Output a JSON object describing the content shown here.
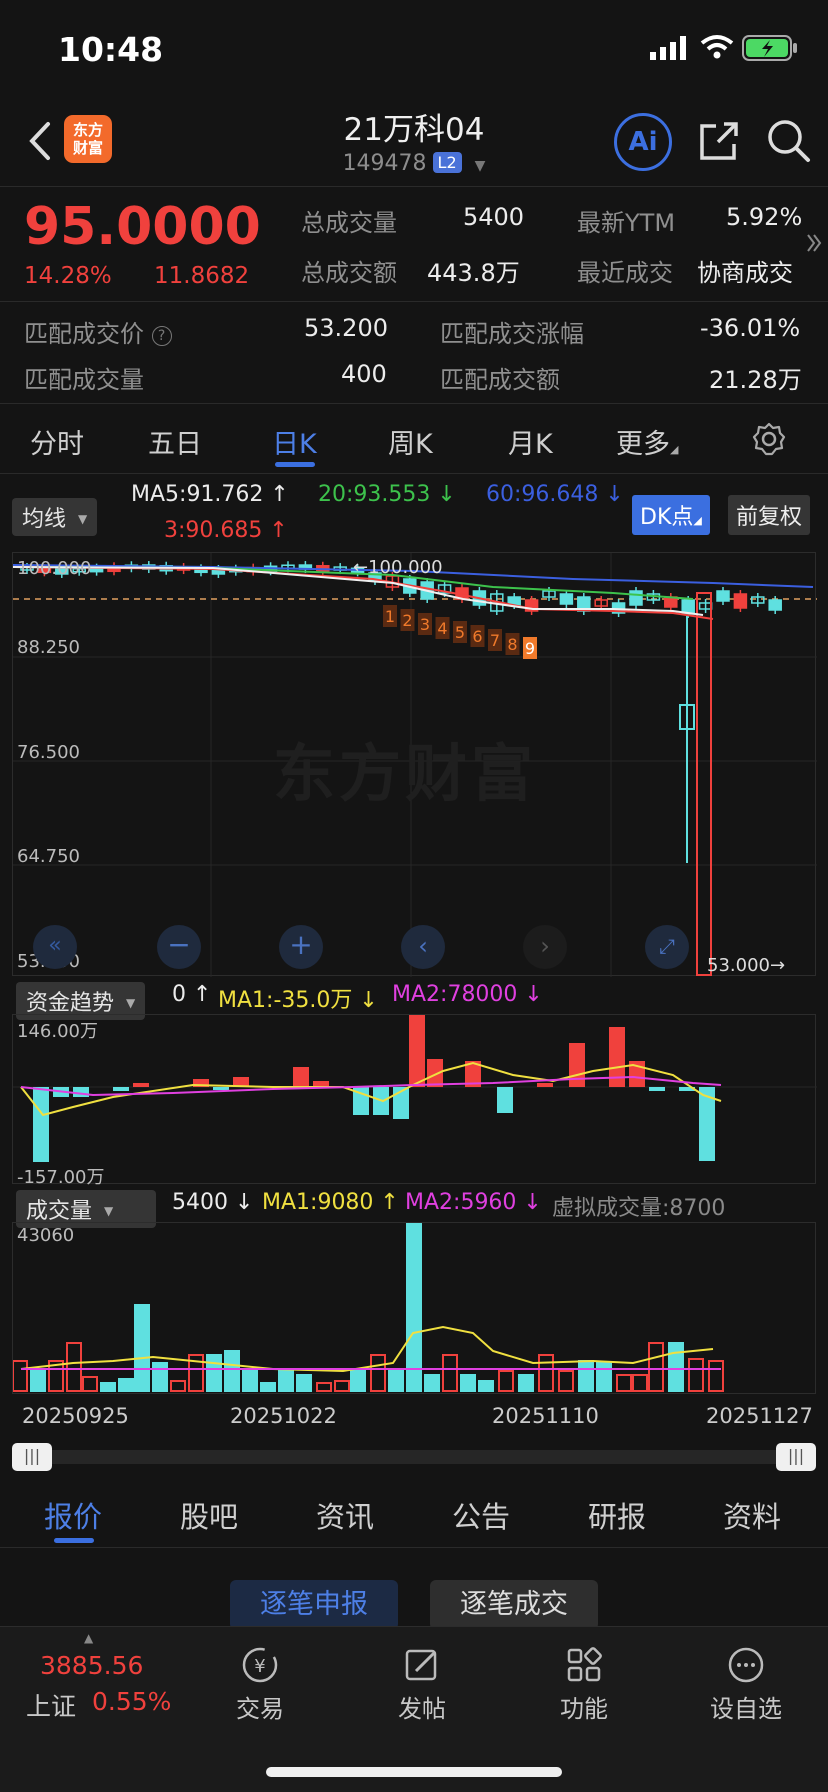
{
  "status_bar": {
    "time": "10:48"
  },
  "header": {
    "logo_text": "东方财富",
    "title": "21万科04",
    "code": "149478",
    "level_badge": "L2",
    "ai_label": "Ai"
  },
  "quote": {
    "price": "95.0000",
    "change_pct": "14.28%",
    "change_amt": "11.8682",
    "rows": [
      {
        "label": "总成交量",
        "value": "5400",
        "label2": "最新YTM",
        "value2": "5.92%"
      },
      {
        "label": "总成交额",
        "value": "443.8万",
        "label2": "最近成交",
        "value2": "协商成交"
      }
    ]
  },
  "match": {
    "price_label": "匹配成交价",
    "price_value": "53.200",
    "change_label": "匹配成交涨幅",
    "change_value": "-36.01%",
    "volume_label": "匹配成交量",
    "volume_value": "400",
    "amount_label": "匹配成交额",
    "amount_value": "21.28万"
  },
  "k_tabs": [
    "分时",
    "五日",
    "日K",
    "周K",
    "月K",
    "更多"
  ],
  "ma_bar": {
    "selector": "均线",
    "ma5": "MA5:91.762",
    "ma20": "20:93.553",
    "ma60": "60:96.648",
    "ma3": "3:90.685",
    "dk_button": "DK点",
    "restore_button": "前复权"
  },
  "main_chart": {
    "y_labels": [
      "100.000",
      "88.250",
      "76.500",
      "64.750",
      "53.000"
    ],
    "max_label": "←100.000",
    "min_label": "53.000→",
    "watermark": "东方财富",
    "markers": [
      "1",
      "2",
      "3",
      "4",
      "5",
      "6",
      "7",
      "8",
      "9"
    ]
  },
  "money_bar": {
    "selector": "资金趋势",
    "value": "0",
    "ma1": "MA1:-35.0万",
    "ma2": "MA2:78000",
    "top_label": "146.00万",
    "bottom_label": "-157.00万"
  },
  "vol_bar": {
    "selector": "成交量",
    "value": "5400",
    "ma1": "MA1:9080",
    "ma2": "MA2:5960",
    "virtual": "虚拟成交量:8700",
    "top_label": "43060",
    "dates": [
      "20250925",
      "20251022",
      "20251110",
      "20251127"
    ]
  },
  "bottom_tabs": [
    "报价",
    "股吧",
    "资讯",
    "公告",
    "研报",
    "资料"
  ],
  "sub_buttons": {
    "orders": "逐笔申报",
    "trades": "逐笔成交"
  },
  "footer": {
    "index_value": "3885.56",
    "index_name": "上证",
    "index_change": "0.55%",
    "items": [
      "交易",
      "发帖",
      "功能",
      "设自选"
    ]
  },
  "colors": {
    "up": "#f0413d",
    "down": "#3dc24c",
    "accent": "#3b6fe0",
    "candle_down": "#5fe0e0"
  }
}
